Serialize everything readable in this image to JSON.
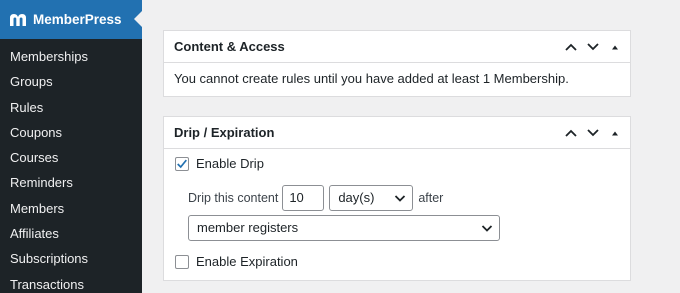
{
  "sidebar": {
    "brand": "MemberPress",
    "items": [
      {
        "label": "Memberships"
      },
      {
        "label": "Groups"
      },
      {
        "label": "Rules"
      },
      {
        "label": "Coupons"
      },
      {
        "label": "Courses"
      },
      {
        "label": "Reminders"
      },
      {
        "label": "Members"
      },
      {
        "label": "Affiliates"
      },
      {
        "label": "Subscriptions"
      },
      {
        "label": "Transactions"
      }
    ]
  },
  "content_access": {
    "title": "Content & Access",
    "message": "You cannot create rules until you have added at least 1 Membership."
  },
  "drip": {
    "title": "Drip / Expiration",
    "enable_drip": {
      "label": "Enable Drip",
      "checked": true
    },
    "drip_prefix": "Drip this content",
    "drip_value": "10",
    "drip_unit": "day(s)",
    "drip_after": "after",
    "drip_event": "member registers",
    "enable_expiration": {
      "label": "Enable Expiration",
      "checked": false
    }
  },
  "colors": {
    "sidebar_bg": "#1d2327",
    "brand_bg": "#2271b1",
    "check": "#2271b1"
  },
  "icons": {
    "brand": "memberpress-logo-icon",
    "move_up": "chevron-up-icon",
    "move_down": "chevron-down-icon",
    "toggle": "triangle-up-icon",
    "checkmark": "checkmark-icon",
    "select_arrow": "chevron-down-icon"
  }
}
